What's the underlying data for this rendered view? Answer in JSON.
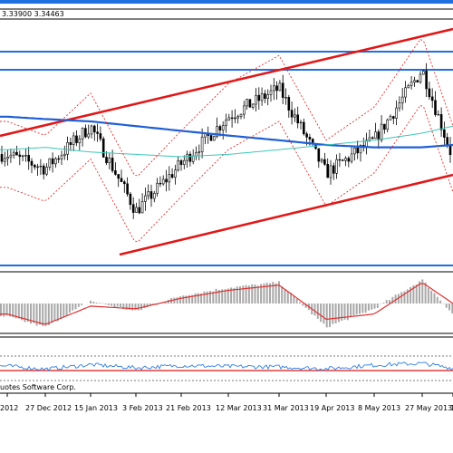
{
  "header": {
    "price_text": "3.33900 3.34463"
  },
  "footer": {
    "copyright": "uotes Software Corp."
  },
  "colors": {
    "candle": "#000000",
    "ma_long": "#1f5fd6",
    "ma_short": "#3cc7b8",
    "bollinger": "#e03030",
    "channel": "#e01818",
    "horizontal_lines": "#1f6fe0",
    "macd_hist": "#a8a8a8",
    "macd_signal": "#e03030",
    "rsi": "#2f7fe0",
    "rsi_level": "#e03030"
  },
  "x_ticks": [
    "2012",
    "27 Dec 2012",
    "15 Jan 2013",
    "3 Feb 2013",
    "21 Feb 2013",
    "12 Mar 2013",
    "31 Mar 2013",
    "19 Apr 2013",
    "8 May 2013",
    "27 May 2013",
    "1"
  ],
  "chart_data": [
    {
      "type": "line",
      "panel": "price",
      "x": [
        "2012",
        "27 Dec 2012",
        "15 Jan 2013",
        "3 Feb 2013",
        "21 Feb 2013",
        "12 Mar 2013",
        "31 Mar 2013",
        "19 Apr 2013",
        "8 May 2013",
        "27 May 2013",
        "1"
      ],
      "series": [
        {
          "values": [
            46,
            40,
            58,
            22,
            42,
            62,
            74,
            38,
            52,
            82,
            44
          ]
        },
        {
          "values": [
            62,
            61,
            60,
            58,
            56,
            54,
            52,
            50,
            49,
            49,
            50
          ]
        },
        {
          "values": [
            48,
            49,
            47,
            46,
            45,
            46,
            48,
            50,
            52,
            55,
            58
          ]
        }
      ],
      "ylim": [
        0,
        100
      ],
      "grid": false
    },
    {
      "type": "bar",
      "panel": "macd",
      "x": [
        "2012",
        "27 Dec 2012",
        "15 Jan 2013",
        "3 Feb 2013",
        "21 Feb 2013",
        "12 Mar 2013",
        "31 Mar 2013",
        "19 Apr 2013",
        "8 May 2013",
        "27 May 2013",
        "1"
      ],
      "series": [
        {
          "values": [
            -0.5,
            -0.9,
            0.1,
            -0.3,
            0.3,
            0.6,
            0.8,
            -0.9,
            -0.2,
            0.9,
            -0.4
          ]
        },
        {
          "values": [
            -0.4,
            -0.8,
            -0.1,
            -0.2,
            0.2,
            0.5,
            0.7,
            -0.6,
            -0.4,
            0.8,
            0.0
          ]
        }
      ],
      "ylim": [
        -1,
        1
      ]
    },
    {
      "type": "line",
      "panel": "oscillator",
      "x": [
        "2012",
        "27 Dec 2012",
        "15 Jan 2013",
        "3 Feb 2013",
        "21 Feb 2013",
        "12 Mar 2013",
        "31 Mar 2013",
        "19 Apr 2013",
        "8 May 2013",
        "27 May 2013",
        "1"
      ],
      "series": [
        {
          "values": [
            52,
            45,
            55,
            48,
            53,
            51,
            50,
            46,
            54,
            58,
            47
          ]
        }
      ],
      "ylim": [
        0,
        100
      ]
    }
  ]
}
